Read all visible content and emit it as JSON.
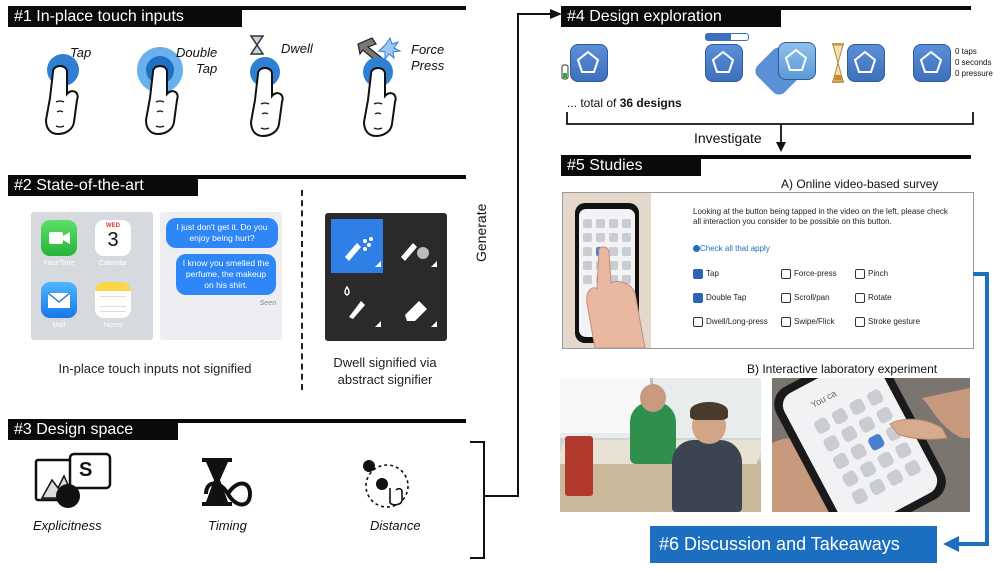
{
  "sections": {
    "s1": "#1 In-place touch inputs",
    "s2": "#2 State-of-the-art",
    "s3": "#3 Design space",
    "s4": "#4 Design exploration",
    "s5": "#5 Studies",
    "s6": "#6 Discussion and Takeaways"
  },
  "touch_inputs": {
    "tap": "Tap",
    "double_tap_1": "Double",
    "double_tap_2": "Tap",
    "dwell": "Dwell",
    "force_1": "Force",
    "force_2": "Press"
  },
  "state_of_art": {
    "calendar_day": "WED",
    "calendar_date": "3",
    "app_facetime": "FaceTime",
    "app_calendar": "Calendar",
    "app_mail": "Mail",
    "app_notes": "Notes",
    "chat_msg1": "I just don't get it. Do you enjoy being hurt?",
    "chat_msg2": "I know you smelled the perfume, the makeup on his shirt.",
    "chat_status": "Seen",
    "caption_left": "In-place touch inputs not signified",
    "caption_right_1": "Dwell signified via",
    "caption_right_2": "abstract signifier"
  },
  "design_space": {
    "explicitness": "Explicitness",
    "timing": "Timing",
    "distance": "Distance",
    "s_letter": "S"
  },
  "arrows": {
    "generate": "Generate",
    "investigate": "Investigate"
  },
  "exploration": {
    "readout_taps": "0 taps",
    "readout_seconds": "0 seconds",
    "readout_pressure": "0 pressure",
    "total_prefix": "... total of ",
    "total_bold": "36 designs"
  },
  "studies": {
    "a_title": "A) Online video-based survey",
    "b_title": "B) Interactive laboratory experiment",
    "survey_question": "Looking at the button being tapped in the video on the left, please check all interaction you consider to be possible on this button.",
    "survey_hint": "Check all that apply",
    "options": [
      {
        "label": "Tap",
        "checked": true
      },
      {
        "label": "Force-press",
        "checked": false
      },
      {
        "label": "Pinch",
        "checked": false
      },
      {
        "label": "Double Tap",
        "checked": true
      },
      {
        "label": "Scroll/pan",
        "checked": false
      },
      {
        "label": "Rotate",
        "checked": false
      },
      {
        "label": "Dwell/Long-press",
        "checked": false
      },
      {
        "label": "Swipe/Flick",
        "checked": false
      },
      {
        "label": "Stroke gesture",
        "checked": false
      }
    ],
    "phone_overlay_text": "You ca"
  },
  "colors": {
    "accent_blue": "#1c6fc0",
    "button_blue": "#3d6fbd",
    "header_black": "#0a0a0a"
  }
}
